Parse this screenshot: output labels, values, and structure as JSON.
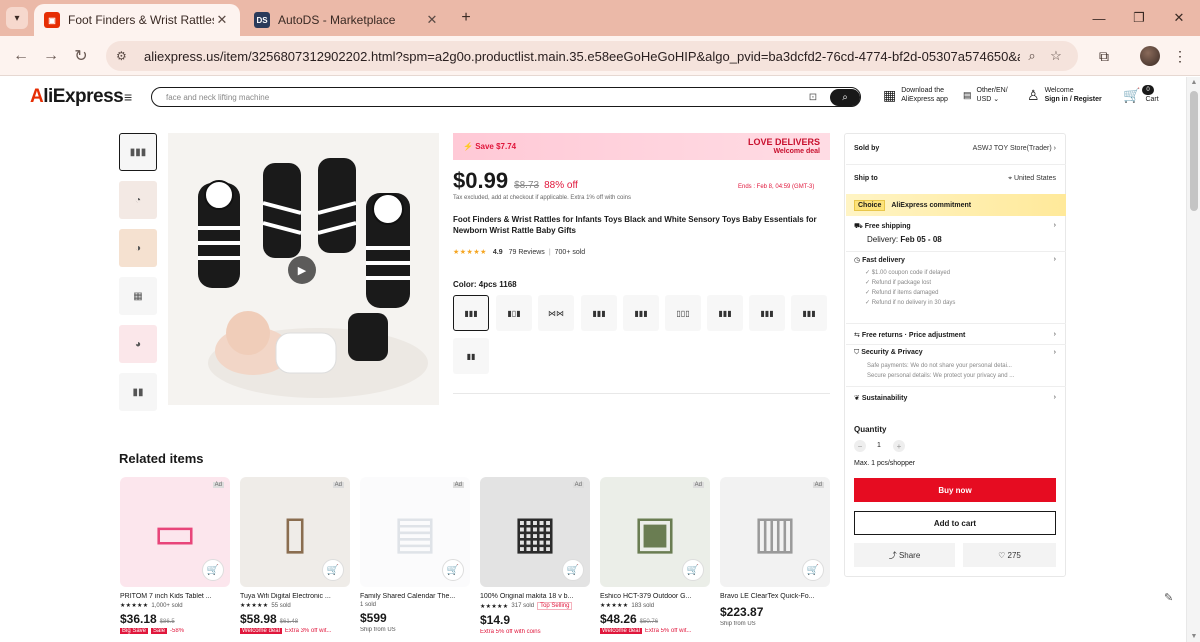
{
  "browser": {
    "tabs": [
      {
        "title": "Foot Finders & Wrist Rattles for"
      },
      {
        "title": "AutoDS - Marketplace"
      }
    ],
    "url": "aliexpress.us/item/3256807312902202.html?spm=a2g0o.productlist.main.35.e58eeGoHeGoHIP&algo_pvid=ba3dcfd2-76cd-4774-bf2d-05307a574650&algo_ex..."
  },
  "header": {
    "logo_a": "A",
    "logo_rest": "liExpress",
    "search_placeholder": "face and neck lifting machine",
    "app_line1": "Download the",
    "app_line2": "AliExpress app",
    "locale_line1": "Other/EN/",
    "locale_line2": "USD",
    "account_line1": "Welcome",
    "account_line2": "Sign in / Register",
    "cart_count": "0",
    "cart_label": "Cart"
  },
  "product": {
    "save_banner": "Save $7.74",
    "love_line1": "LOVE DELIVERS",
    "love_line2": "Welcome deal",
    "price": "$0.99",
    "original_price": "$8.73",
    "discount": "88% off",
    "ends": "Ends : Feb 8, 04:59 (GMT-3)",
    "tax_note": "Tax excluded, add at checkout if applicable. Extra 1% off with coins",
    "title": "Foot Finders & Wrist Rattles for Infants Toys Black and White Sensory Toys Baby Essentials for Newborn Wrist Rattle Baby Gifts",
    "stars": "★★★★★",
    "rating": "4.9",
    "reviews": "79 Reviews",
    "sold": "700+ sold",
    "color_label": "Color: 4pcs 1168"
  },
  "panel": {
    "sold_by_label": "Sold by",
    "store": "ASWJ TOY Store(Trader)",
    "ship_to_label": "Ship to",
    "ship_to": "United States",
    "choice_tag": "Choice",
    "choice_text": "AliExpress commitment",
    "free_shipping": "Free shipping",
    "delivery_label": "Delivery:",
    "delivery_dates": "Feb 05 - 08",
    "fast_delivery": "Fast delivery",
    "fast_items": [
      "$1.00 coupon code if delayed",
      "Refund if package lost",
      "Refund if items damaged",
      "Refund if no delivery in 30 days"
    ],
    "free_returns": "Free returns · Price adjustment",
    "security": "Security & Privacy",
    "security_items": [
      "Safe payments: We do not share your personal detai...",
      "Secure personal details: We protect your privacy and ..."
    ],
    "sustainability": "Sustainability",
    "quantity_label": "Quantity",
    "quantity": "1",
    "max_note": "Max. 1 pcs/shopper",
    "buy_now": "Buy now",
    "add_to_cart": "Add to cart",
    "share": "Share",
    "wishlist_count": "275"
  },
  "related": {
    "heading": "Related items",
    "items": [
      {
        "name": "PRITOM 7 inch Kids Tablet ...",
        "stars": "★★★★★",
        "sold": "1,000+ sold",
        "price": "$36.18",
        "orig": "$86.5",
        "badge": "Big Save",
        "tag": "Sale",
        "promo": "-58%",
        "color": "#e8457a",
        "emoji": "▭"
      },
      {
        "name": "Tuya Wifi Digital Electronic ...",
        "stars": "★★★★★",
        "sold": "55 sold",
        "price": "$58.98",
        "orig": "$61.48",
        "badge": "Welcome deal",
        "tag": "",
        "promo": "Extra 3% off wit...",
        "color": "#8a6d4f",
        "emoji": "▯"
      },
      {
        "name": "Family Shared Calendar The...",
        "stars": "",
        "sold": "1 sold",
        "price": "$599",
        "orig": "",
        "badge": "",
        "tag": "",
        "promo": "Ship from US",
        "color": "#dfe3e8",
        "emoji": "▤"
      },
      {
        "name": "100% Original makita 18 v b...",
        "stars": "★★★★★",
        "sold": "317 sold",
        "price": "$14.9",
        "orig": "",
        "badge": "",
        "tag": "Top Selling",
        "promo": "Extra 5% off with coins",
        "color": "#2b2b2b",
        "emoji": "▦"
      },
      {
        "name": "Eshico HCT-379 Outdoor G...",
        "stars": "★★★★★",
        "sold": "183 sold",
        "price": "$48.26",
        "orig": "$50.76",
        "badge": "Welcome deal",
        "tag": "",
        "promo": "Extra 5% off wit...",
        "color": "#6a7d52",
        "emoji": "▣"
      },
      {
        "name": "Bravo LE ClearTex Quick-Fo...",
        "stars": "",
        "sold": "",
        "price": "$223.87",
        "orig": "",
        "badge": "",
        "tag": "",
        "promo": "Ship from US",
        "color": "#9a9a9a",
        "emoji": "▥"
      }
    ]
  }
}
